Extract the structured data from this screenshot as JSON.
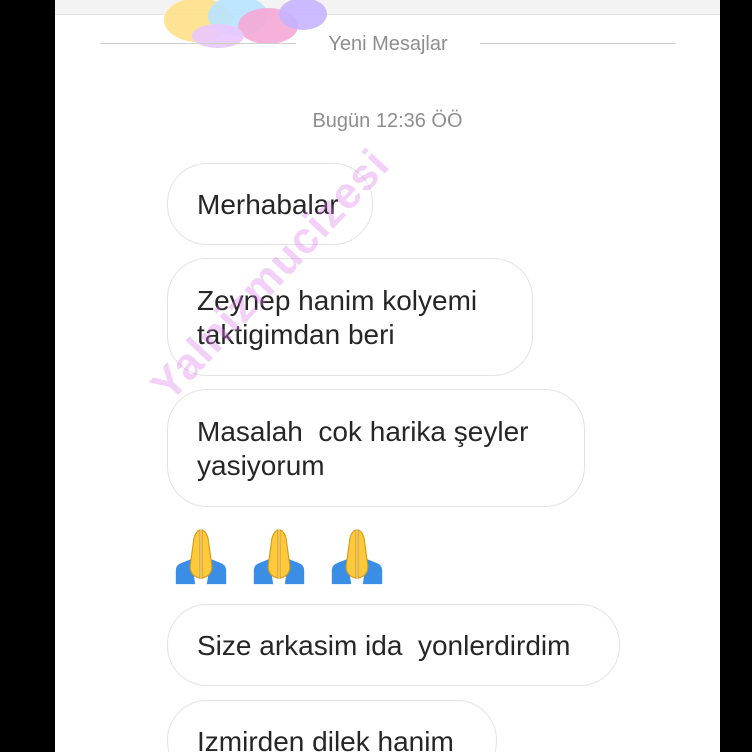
{
  "chat": {
    "new_messages_label": "Yeni Mesajlar",
    "timestamp": "Bugün 12:36 ÖÖ",
    "messages": [
      {
        "text": "Merhabalar"
      },
      {
        "text": "Zeynep hanim kolyemi\ntaktigimdan beri"
      },
      {
        "text": "Masalah  cok harika şeyler\nyasiyorum"
      },
      {
        "text": "Size arkasim ida  yonlerdirdim"
      },
      {
        "text": "Izmirden dilek hanim"
      }
    ],
    "reaction_emojis": [
      "folded-hands-icon",
      "folded-hands-icon",
      "folded-hands-icon"
    ]
  },
  "watermark": {
    "text": "Yalnizmucizesi"
  },
  "colors": {
    "bubble_border": "#e3e3e3",
    "meta_text": "#8e8e8e",
    "message_text": "#262626",
    "watermark": "#dc78eb"
  }
}
